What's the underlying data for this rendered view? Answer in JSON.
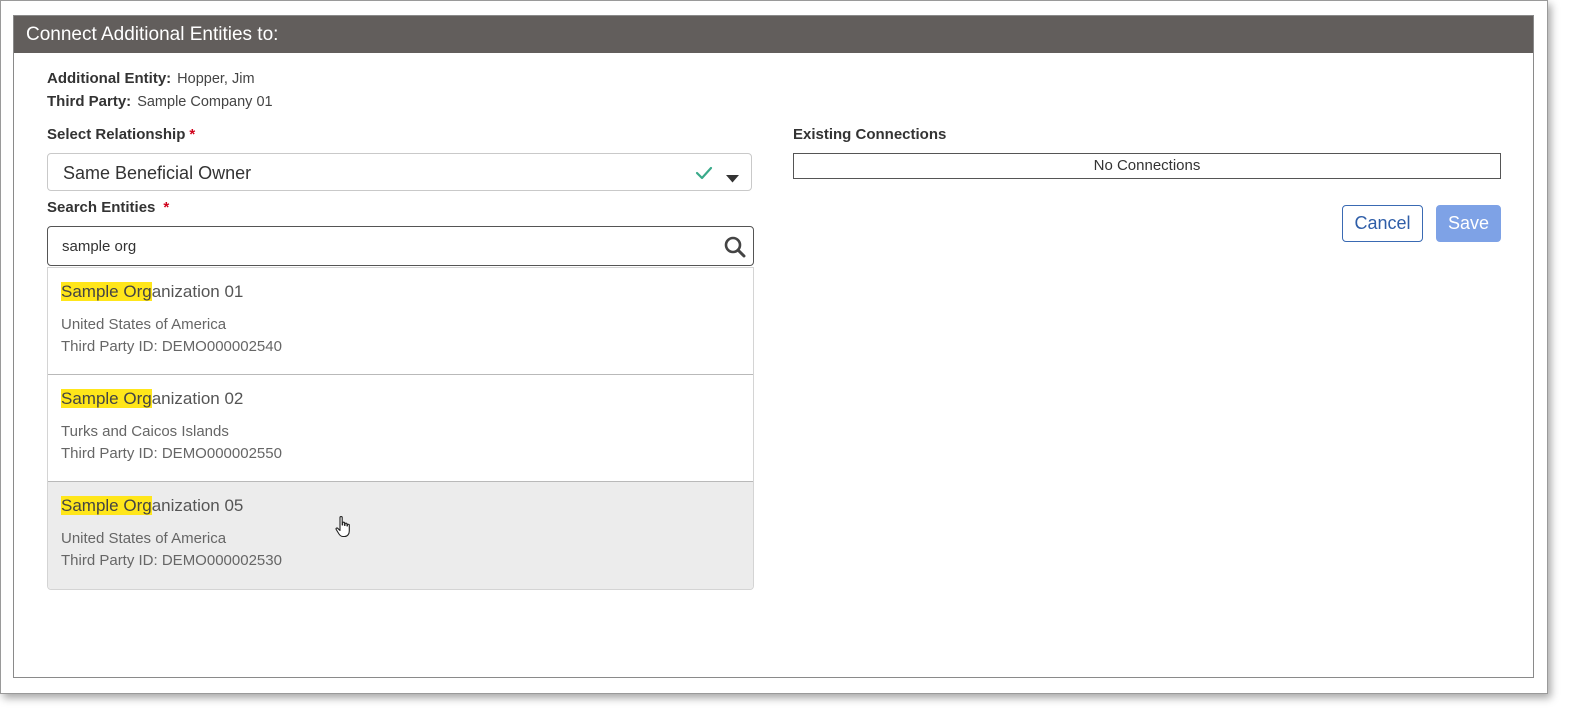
{
  "header": {
    "title": "Connect Additional Entities to:"
  },
  "info": {
    "additional_entity_label": "Additional Entity:",
    "additional_entity_value": "Hopper, Jim",
    "third_party_label": "Third Party:",
    "third_party_value": "Sample Company 01"
  },
  "relationship": {
    "label": "Select Relationship",
    "required_mark": "*",
    "selected": "Same Beneficial Owner",
    "check_color": "#3aaa8a"
  },
  "search": {
    "label": "Search Entities",
    "required_mark": "*",
    "value": "sample org",
    "icon": "search-icon"
  },
  "results": [
    {
      "highlight": "Sample Org",
      "rest": "anization 01",
      "country": "United States of America",
      "third_party_id": "Third Party ID: DEMO000002540",
      "hovered": false
    },
    {
      "highlight": "Sample Org",
      "rest": "anization 02",
      "country": "Turks and Caicos Islands",
      "third_party_id": "Third Party ID: DEMO000002550",
      "hovered": false
    },
    {
      "highlight": "Sample Org",
      "rest": "anization 05",
      "country": "United States of America",
      "third_party_id": "Third Party ID: DEMO000002530",
      "hovered": true
    }
  ],
  "existing_connections": {
    "label": "Existing Connections",
    "empty_text": "No Connections"
  },
  "actions": {
    "cancel_label": "Cancel",
    "save_label": "Save"
  },
  "colors": {
    "header_bg": "#625e5c",
    "highlight": "#ffe61a",
    "primary": "#2f5ea8",
    "save_bg": "#7ea2e6",
    "required": "#d0021b"
  }
}
